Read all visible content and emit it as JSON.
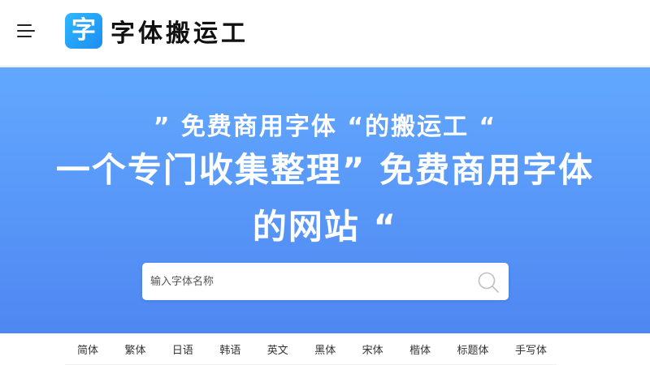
{
  "header": {
    "menu_icon": "hamburger-menu-icon",
    "logo_char": "字",
    "logo_text": "字体搬运工"
  },
  "hero": {
    "subtitle": "” 免费商用字体 “的搬运工 “",
    "title": "一个专门收集整理” 免费商用字体的网站 “",
    "background_top": "#62a8ff",
    "background_bottom": "#4f87f1"
  },
  "search": {
    "placeholder": "输入字体名称",
    "value": "",
    "icon": "search-icon"
  },
  "categories": [
    "简体",
    "繁体",
    "日语",
    "韩语",
    "英文",
    "黑体",
    "宋体",
    "楷体",
    "标题体",
    "手写体"
  ]
}
